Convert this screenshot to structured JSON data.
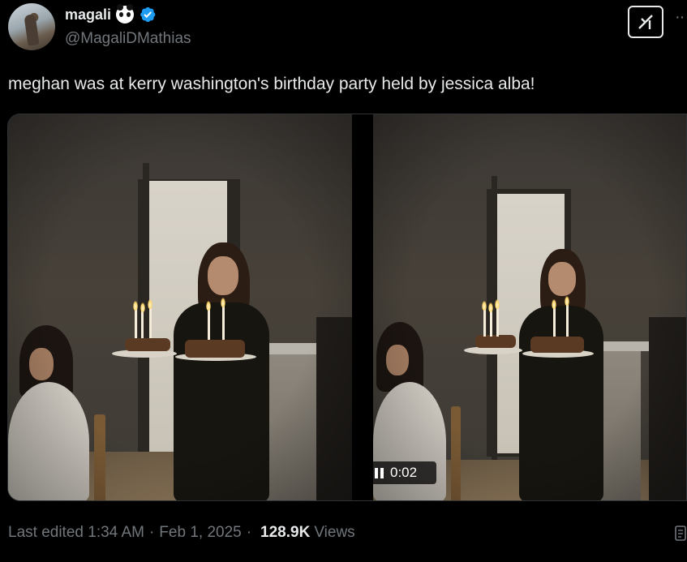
{
  "author": {
    "display_name": "magali",
    "handle": "@MagaliDMathias"
  },
  "icons": {
    "emoji": "panda-face-icon",
    "verified": "verified-badge-icon",
    "grok": "grok-icon",
    "more": "more-options-icon",
    "pause": "pause-icon",
    "analytics": "analytics-icon"
  },
  "colors": {
    "background": "#000000",
    "text": "#e7e9ea",
    "secondary_text": "#71767b",
    "verified": "#1d9bf0"
  },
  "tweet": {
    "text": "meghan was at kerry washington's birthday party held by jessica alba!"
  },
  "video": {
    "time": "0:02"
  },
  "meta": {
    "edited_label": "Last edited",
    "time": "1:34 AM",
    "date": "Feb 1, 2025",
    "views_count": "128.9K",
    "views_label": "Views"
  }
}
